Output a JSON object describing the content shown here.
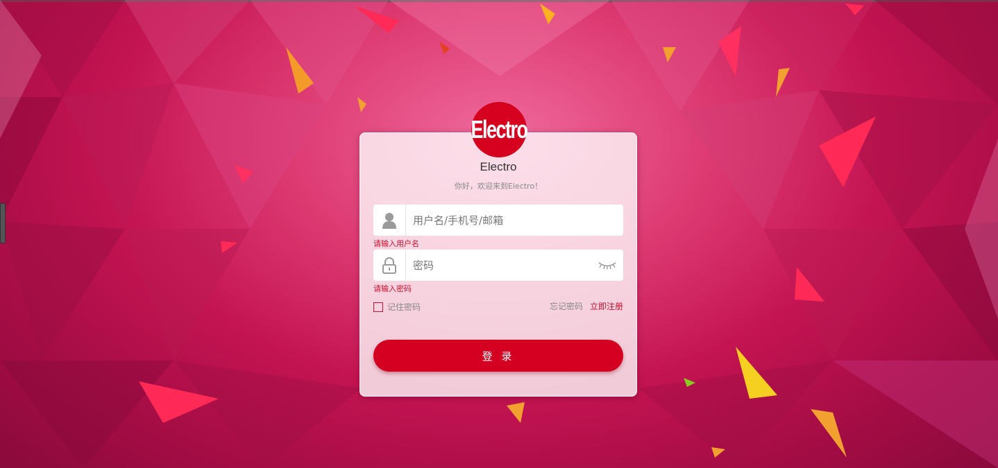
{
  "logo": {
    "text": "Electro"
  },
  "brand": {
    "name": "Electro",
    "welcome": "你好，欢迎来到Electro！"
  },
  "login_form": {
    "username": {
      "placeholder": "用户名/手机号/邮箱",
      "value": "",
      "error": "请输入用户名",
      "icon": "user-icon"
    },
    "password": {
      "placeholder": "密码",
      "value": "",
      "error": "请输入密码",
      "icon": "lock-icon",
      "toggle_icon": "eye-closed-icon"
    },
    "remember_label": "记住密码",
    "remember_checked": false,
    "forgot_label": "忘记密码",
    "register_label": "立即注册",
    "submit_label": "登 录"
  },
  "colors": {
    "accent": "#d40021",
    "error": "#c8102e",
    "background": "#c41452"
  }
}
